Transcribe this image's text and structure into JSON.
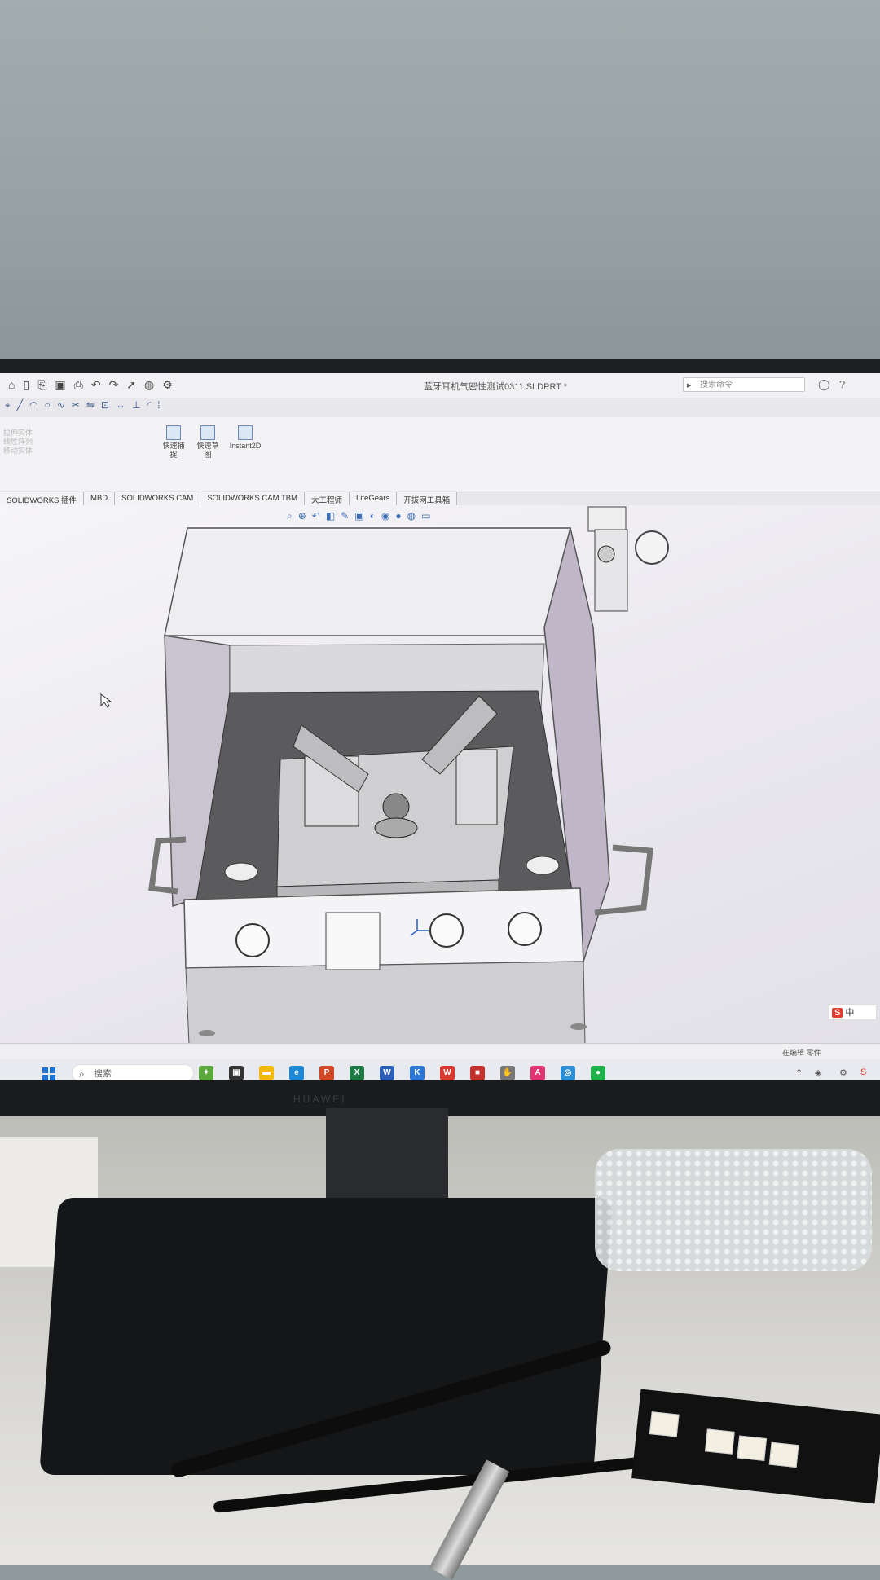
{
  "window": {
    "title": "蓝牙耳机气密性测试0311.SLDPRT *",
    "search_placeholder": "搜索命令"
  },
  "ribbon": {
    "left_faded": [
      "拉伸实体",
      "线性阵列",
      "移动实体"
    ],
    "items": [
      {
        "label": "快速捕捉",
        "faded": false
      },
      {
        "label": "快速草图",
        "faded": false
      },
      {
        "label": "Instant2D",
        "faded": false
      }
    ]
  },
  "tabs": [
    "SOLIDWORKS 插件",
    "MBD",
    "SOLIDWORKS CAM",
    "SOLIDWORKS CAM TBM",
    "大工程师",
    "LiteGears",
    "开拔网工具箱"
  ],
  "status": {
    "text": "在编辑 零件"
  },
  "taskbar": {
    "search_label": "搜索",
    "apps": [
      {
        "name": "widgets",
        "color": "#5aa83d",
        "glyph": "✦"
      },
      {
        "name": "task-view",
        "color": "#333333",
        "glyph": "▣"
      },
      {
        "name": "explorer",
        "color": "#f2b90c",
        "glyph": "▬"
      },
      {
        "name": "edge",
        "color": "#1c88d6",
        "glyph": "e"
      },
      {
        "name": "powerpoint",
        "color": "#d24726",
        "glyph": "P"
      },
      {
        "name": "excel",
        "color": "#1d7a44",
        "glyph": "X"
      },
      {
        "name": "word",
        "color": "#2b5eb8",
        "glyph": "W"
      },
      {
        "name": "app-blue",
        "color": "#2c77d6",
        "glyph": "K"
      },
      {
        "name": "wps",
        "color": "#d93a2f",
        "glyph": "W"
      },
      {
        "name": "app-red",
        "color": "#c4302b",
        "glyph": "■"
      },
      {
        "name": "app-tool",
        "color": "#777777",
        "glyph": "✋"
      },
      {
        "name": "app-pink",
        "color": "#e03370",
        "glyph": "A"
      },
      {
        "name": "app-cyan",
        "color": "#2b8fd8",
        "glyph": "◎"
      },
      {
        "name": "wechat",
        "color": "#1fb14a",
        "glyph": "●"
      }
    ]
  },
  "ime": {
    "badge": "S",
    "label": "中"
  },
  "monitor": {
    "brand": "HUAWEI"
  }
}
